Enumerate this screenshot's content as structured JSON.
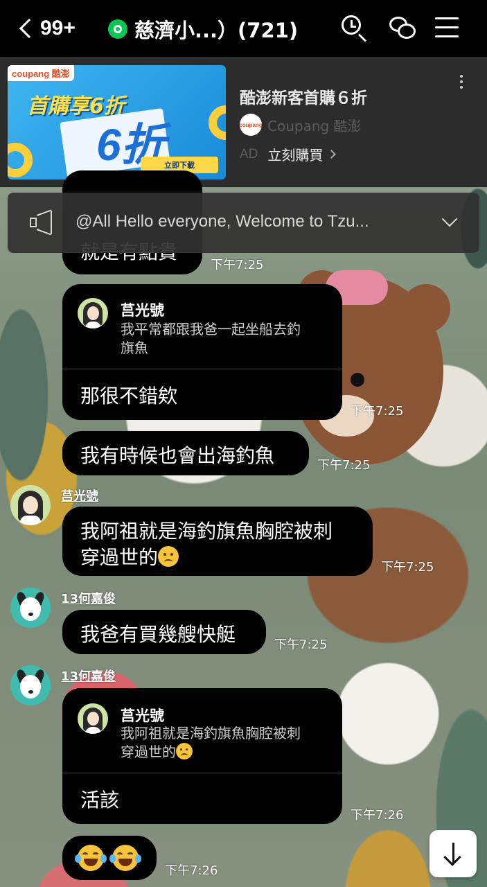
{
  "topbar": {
    "back_count": "99+",
    "group_name": "慈濟小...）(721)",
    "icons": [
      "chevron-left-icon",
      "search-history-icon",
      "chat-bubbles-icon",
      "menu-icon"
    ]
  },
  "ad": {
    "image_brand": "coupang 酷澎",
    "image_headline": "首購享6折",
    "image_big": "6折",
    "image_button": "立即下載",
    "title": "酷澎新客首購６折",
    "brand_logo": "coupang",
    "brand_name": "Coupang 酷澎",
    "label": "AD",
    "cta": "立刻購買"
  },
  "announcement": {
    "text": "@All  Hello everyone, Welcome to Tzu..."
  },
  "messages": {
    "m0": {
      "text": "就是有點貴",
      "time": "下午7:25"
    },
    "m1": {
      "quote_name": "莒光號",
      "quote_text": "我平常都跟我爸一起坐船去釣\n旗魚",
      "text": "那很不錯欸",
      "time": "下午7:25"
    },
    "m2": {
      "text": "我有時候也會出海釣魚",
      "time": "下午7:25"
    },
    "m3": {
      "sender": "莒光號",
      "line1": "我阿祖就是海釣旗魚胸腔被刺",
      "line2": "穿過世的",
      "time": "下午7:25"
    },
    "m4": {
      "sender": "13何嘉俊",
      "text": "我爸有買幾艘快艇",
      "time": "下午7:25"
    },
    "m5": {
      "sender": "13何嘉俊",
      "quote_name": "莒光號",
      "quote_line1": "我阿祖就是海釣旗魚胸腔被刺",
      "quote_line2": "穿過世的",
      "text": "活該",
      "time": "下午7:26"
    },
    "m6": {
      "time": "下午7:26"
    }
  },
  "colors": {
    "topbar_bg": "#000000",
    "ad_bg": "#2c2c2c",
    "bubble_bg": "#000000",
    "group_badge": "#06c755"
  }
}
